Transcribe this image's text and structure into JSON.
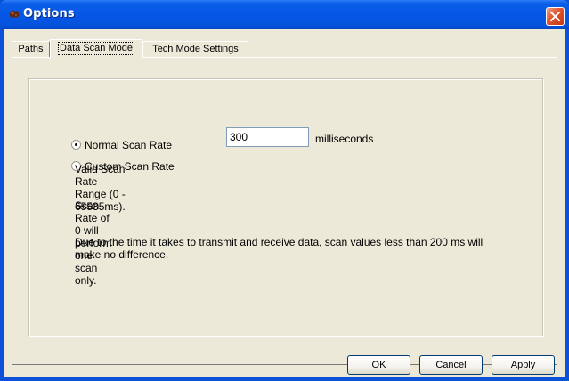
{
  "window": {
    "title": "Options",
    "title_icon": "app-icon",
    "close_icon": "close-x-icon",
    "accent": "#0b52d8",
    "face_color": "#ece9d8",
    "close_color": "#e0532d"
  },
  "tabs": [
    {
      "label": "Paths",
      "active": false
    },
    {
      "label": "Data Scan Mode",
      "active": true
    },
    {
      "label": "Tech Mode Settings",
      "active": false
    }
  ],
  "scan": {
    "normal_label": "Normal Scan Rate",
    "custom_label": "Custom Scan Rate",
    "selected": "normal",
    "value": "300",
    "units": "milliseconds",
    "info_range": "Valid Scan Rate Range (0 - 65535ms).",
    "info_zero": "Scan Rate of 0 will perform one scan only.",
    "info_note": "Due to the time it takes to transmit and receive data, scan  values less than 200 ms will make no difference."
  },
  "buttons": {
    "ok": "OK",
    "cancel": "Cancel",
    "apply": "Apply"
  }
}
